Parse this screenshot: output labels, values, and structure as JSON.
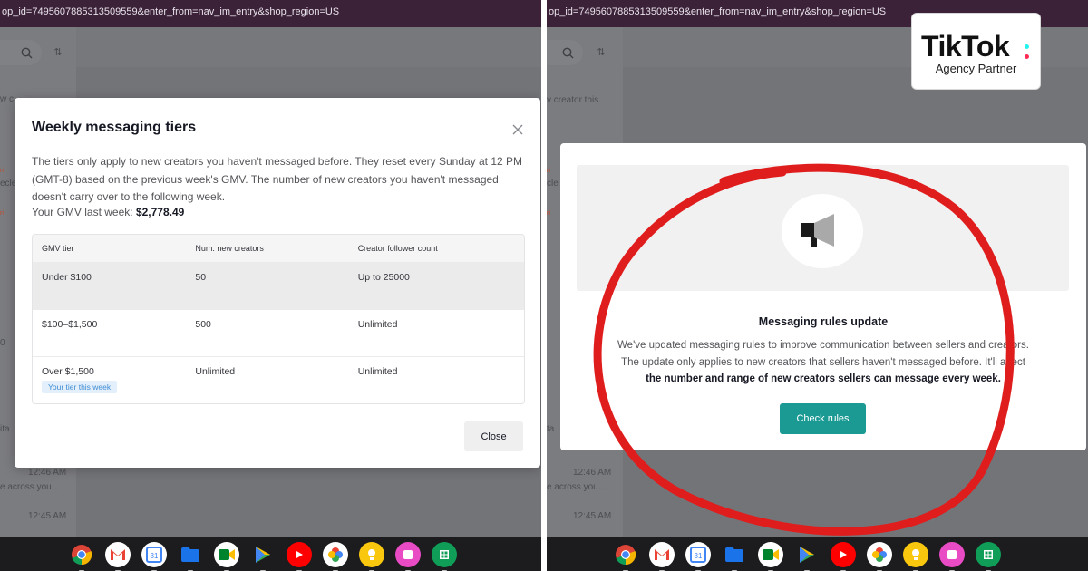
{
  "left": {
    "url": "op_id=7495607885313509559&enter_from=nav_im_entry&shop_region=US",
    "bg_snippets": [
      "w c",
      "ecle",
      "ita",
      "0",
      "12:46 AM",
      "e across you...",
      "12:45 AM"
    ],
    "modal": {
      "title": "Weekly messaging tiers",
      "description": "The tiers only apply to new creators you haven't messaged before. They reset every Sunday at 12 PM (GMT-8) based on the previous week's GMV. The number of new creators you haven't messaged doesn't carry over to the following week.",
      "gmv_label": "Your GMV last week:",
      "gmv_value": "$2,778.49",
      "columns": [
        "GMV tier",
        "Num. new creators",
        "Creator follower count"
      ],
      "rows": [
        {
          "tier": "Under $100",
          "creators": "50",
          "followers": "Up to 25000"
        },
        {
          "tier": "$100–$1,500",
          "creators": "500",
          "followers": "Unlimited"
        },
        {
          "tier": "Over $1,500",
          "creators": "Unlimited",
          "followers": "Unlimited",
          "badge": "Your tier this week"
        }
      ],
      "close_label": "Close"
    }
  },
  "right": {
    "url": "op_id=7495607885313509559&enter_from=nav_im_entry&shop_region=US",
    "bg_snippets": [
      "v creator this",
      "ta",
      "12:46 AM",
      "e across you...",
      "12:45 AM"
    ],
    "badge": {
      "logo": "TikTok",
      "subtitle": "Agency Partner"
    },
    "card": {
      "title": "Messaging rules update",
      "line1": "We've updated messaging rules to improve communication between sellers and creators.",
      "line2": "The update only applies to new creators that sellers haven't messaged before. It'll affect",
      "line3_bold": "the number and range of new creators sellers can message every week.",
      "button": "Check rules"
    }
  },
  "shelf_apps": [
    "chrome-icon",
    "gmail-icon",
    "calendar-icon",
    "files-icon",
    "meet-icon",
    "play-store-icon",
    "youtube-icon",
    "photos-icon",
    "keep-icon",
    "clipboard-app-icon",
    "sheets-icon"
  ],
  "colors": {
    "accent_teal": "#1a9a93",
    "annotation_red": "#e01d1d",
    "tier_badge_blue": "#3f8bd3"
  }
}
